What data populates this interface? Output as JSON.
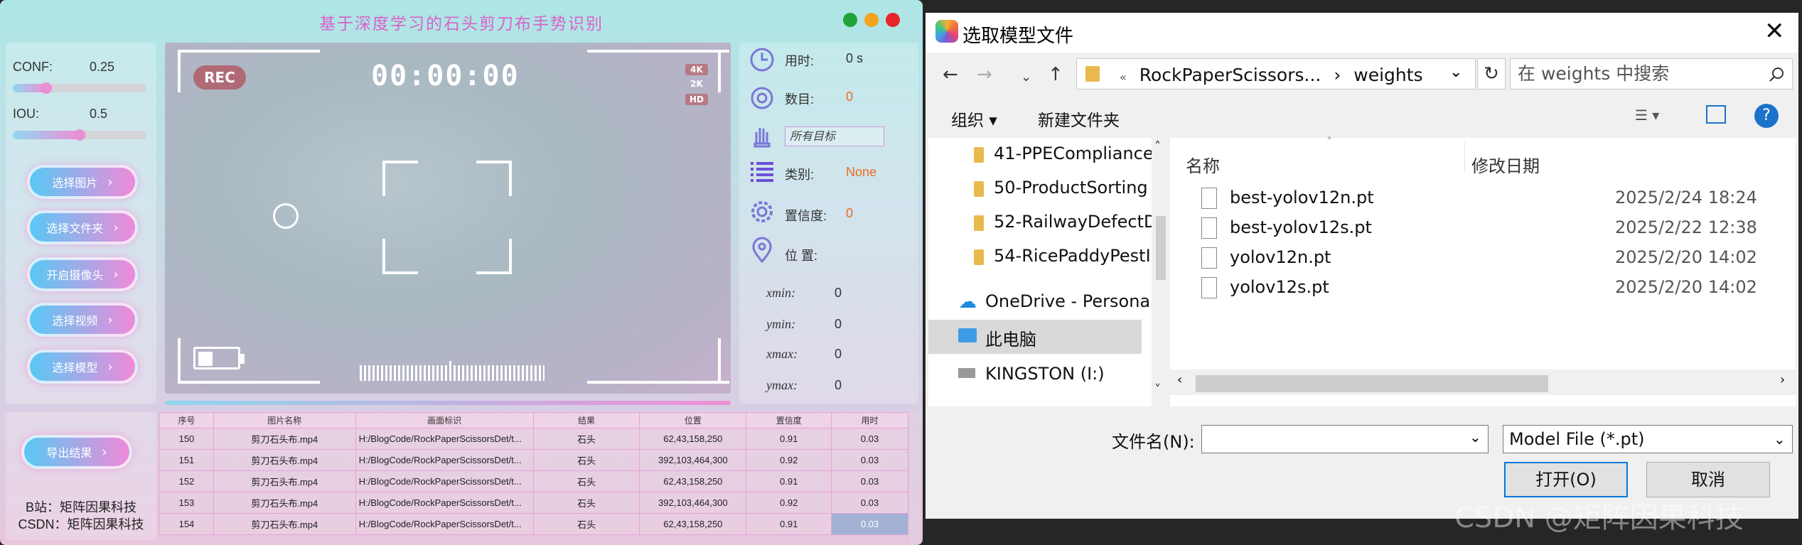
{
  "app": {
    "title": "基于深度学习的石头剪刀布手势识别",
    "window_dots": [
      "#1fa33a",
      "#f3a51f",
      "#e6262b"
    ],
    "sliders": {
      "conf_label": "CONF:",
      "conf_value": "0.25",
      "conf_fraction": 0.25,
      "iou_label": "IOU:",
      "iou_value": "0.5",
      "iou_fraction": 0.5
    },
    "buttons": [
      "选择图片",
      "选择文件夹",
      "开启摄像头",
      "选择视频",
      "选择模型"
    ],
    "export_button": "导出结果",
    "video": {
      "rec": "REC",
      "timer": "00:00:00",
      "res_4k": "4K",
      "res_2k": "2K",
      "res_hd": "HD"
    },
    "info": {
      "time_label": "用时:",
      "time_value": "0 s",
      "count_label": "数目:",
      "count_value": "0",
      "target_select": "所有目标",
      "class_label": "类别:",
      "class_value": "None",
      "conf_label": "置信度:",
      "conf_value": "0",
      "position_label": "位 置:",
      "xmin_label": "xmin:",
      "xmin_value": "0",
      "ymin_label": "ymin:",
      "ymin_value": "0",
      "xmax_label": "xmax:",
      "xmax_value": "0",
      "ymax_label": "ymax:",
      "ymax_value": "0"
    },
    "credits": {
      "bilibili": "B站：矩阵因果科技",
      "csdn": "CSDN：矩阵因果科技"
    },
    "table": {
      "headers": [
        "序号",
        "图片名称",
        "画面标识",
        "结果",
        "位置",
        "置信度",
        "用时"
      ],
      "rows": [
        [
          "150",
          "剪刀石头布.mp4",
          "H:/BlogCode/RockPaperScissorsDet/t...",
          "石头",
          "62,43,158,250",
          "0.91",
          "0.03"
        ],
        [
          "151",
          "剪刀石头布.mp4",
          "H:/BlogCode/RockPaperScissorsDet/t...",
          "石头",
          "392,103,464,300",
          "0.92",
          "0.03"
        ],
        [
          "152",
          "剪刀石头布.mp4",
          "H:/BlogCode/RockPaperScissorsDet/t...",
          "石头",
          "62,43,158,250",
          "0.91",
          "0.03"
        ],
        [
          "153",
          "剪刀石头布.mp4",
          "H:/BlogCode/RockPaperScissorsDet/t...",
          "石头",
          "392,103,464,300",
          "0.92",
          "0.03"
        ],
        [
          "154",
          "剪刀石头布.mp4",
          "H:/BlogCode/RockPaperScissorsDet/t...",
          "石头",
          "62,43,158,250",
          "0.91",
          "0.03"
        ]
      ]
    }
  },
  "dialog": {
    "title": "选取模型文件",
    "address": {
      "path_prefix": "«",
      "folder1": "RockPaperScissors...",
      "sep": "›",
      "folder2": "weights"
    },
    "search_placeholder": "在 weights 中搜索",
    "toolbar": {
      "organize": "组织 ▾",
      "new_folder": "新建文件夹"
    },
    "tree": [
      {
        "label": "41-PPECompliance",
        "icon": "folder-icon"
      },
      {
        "label": "50-ProductSorting",
        "icon": "folder-icon"
      },
      {
        "label": "52-RailwayDefectD",
        "icon": "folder-icon"
      },
      {
        "label": "54-RicePaddyPestI",
        "icon": "folder-icon"
      },
      {
        "label": "OneDrive - Persona",
        "icon": "cloud-icon"
      },
      {
        "label": "此电脑",
        "icon": "computer-icon"
      },
      {
        "label": "KINGSTON (I:)",
        "icon": "drive-icon"
      }
    ],
    "columns": {
      "name": "名称",
      "date": "修改日期"
    },
    "files": [
      {
        "name": "best-yolov12n.pt",
        "date": "2025/2/24 18:24"
      },
      {
        "name": "best-yolov12s.pt",
        "date": "2025/2/22 12:38"
      },
      {
        "name": "yolov12n.pt",
        "date": "2025/2/20 14:02"
      },
      {
        "name": "yolov12s.pt",
        "date": "2025/2/20 14:02"
      }
    ],
    "filename_label": "文件名(N):",
    "filename_value": "",
    "filetype": "Model File (*.pt)",
    "open_button": "打开(O)",
    "cancel_button": "取消"
  },
  "watermark": "CSDN @矩阵因果科技"
}
